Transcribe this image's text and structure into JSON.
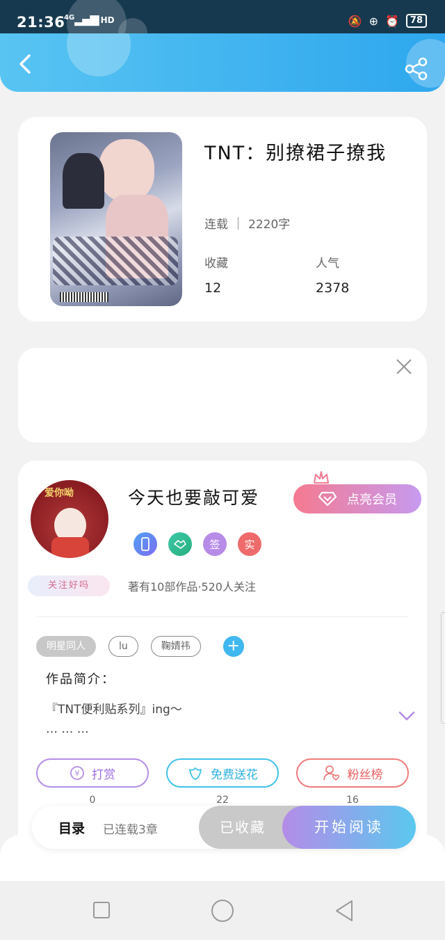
{
  "status_bar": {
    "time": "21:36",
    "network": "4G",
    "hd": "HD",
    "battery": "78"
  },
  "book": {
    "title": "TNT：别撩裙子撩我",
    "status": "连载",
    "word_count": "2220字",
    "stats": [
      {
        "label": "收藏",
        "value": "12"
      },
      {
        "label": "人气",
        "value": "2378"
      }
    ]
  },
  "author": {
    "avatar_text": "爱你呦",
    "follow_badge": "关注好吗",
    "name": "今天也要敲可爱",
    "vip_button": "点亮会员",
    "badges": [
      "签",
      "实"
    ],
    "works_line": "著有10部作品·520人关注"
  },
  "tags": [
    "明星同人",
    "lu",
    "鞠婧祎"
  ],
  "intro": {
    "label": "作品简介：",
    "line1": "『TNT便利贴系列』ing～",
    "line2": "… … …"
  },
  "actions": [
    {
      "label": "打赏",
      "count": "0"
    },
    {
      "label": "免费送花",
      "count": "22"
    },
    {
      "label": "粉丝榜",
      "count": "16"
    }
  ],
  "bottom_bar": {
    "toc_label": "目录",
    "toc_sub": "已连载3章",
    "collected_label": "已收藏",
    "start_label": "开始阅读"
  },
  "colors": {
    "nav_gradient_start": "#58c4f2",
    "nav_gradient_end": "#2ea7ee",
    "vip_start": "#f57a90",
    "vip_end": "#c69af0"
  }
}
